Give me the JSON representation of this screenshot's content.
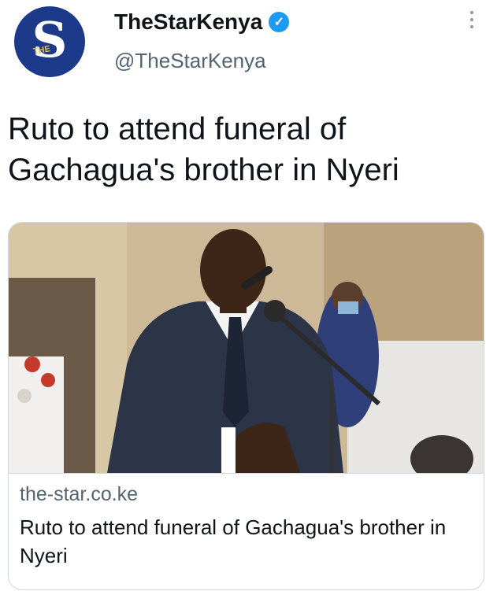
{
  "account": {
    "display_name": "TheStarKenya",
    "handle": "@TheStarKenya",
    "avatar_letter": "S",
    "avatar_sub": "THE",
    "verified_icon": "✓"
  },
  "tweet": {
    "text": "Ruto to attend funeral of Gachagua's brother in Nyeri"
  },
  "link_card": {
    "domain": "the-star.co.ke",
    "title": "Ruto to attend funeral of Gachagua's brother in Nyeri"
  },
  "colors": {
    "avatar_bg": "#1d3a8a",
    "verified": "#1d9bf0",
    "secondary_text": "#536471"
  }
}
